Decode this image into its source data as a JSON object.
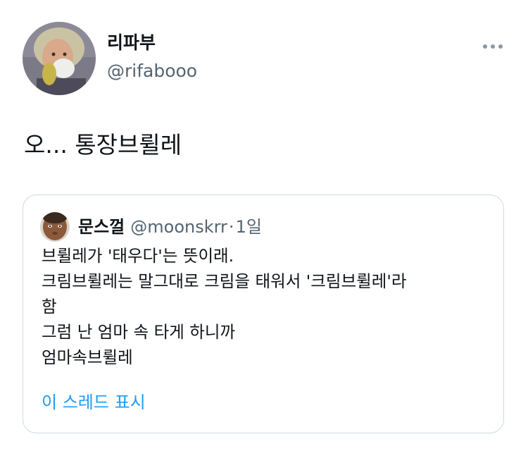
{
  "tweet": {
    "author": {
      "display_name": "리파부",
      "handle": "@rifabooo",
      "avatar_icon": "portrait-avatar"
    },
    "more_icon": "more-dots-icon",
    "text": "오... 통장브륄레"
  },
  "quoted_tweet": {
    "author": {
      "display_name": "문스껄",
      "handle": "@moonskrr",
      "avatar_icon": "face-avatar"
    },
    "separator": "·",
    "time": "1일",
    "lines": [
      "브륄레가 '태우다'는 뜻이래.",
      "크림브륄레는 말그대로 크림을 태워서 '크림브륄레'라",
      "함",
      "그럼 난 엄마 속 타게 하니까",
      "엄마속브륄레"
    ],
    "show_thread_label": "이 스레드 표시"
  },
  "colors": {
    "text_primary": "#0f1419",
    "text_secondary": "#536471",
    "link": "#1d9bf0",
    "border": "#cfd9de"
  }
}
